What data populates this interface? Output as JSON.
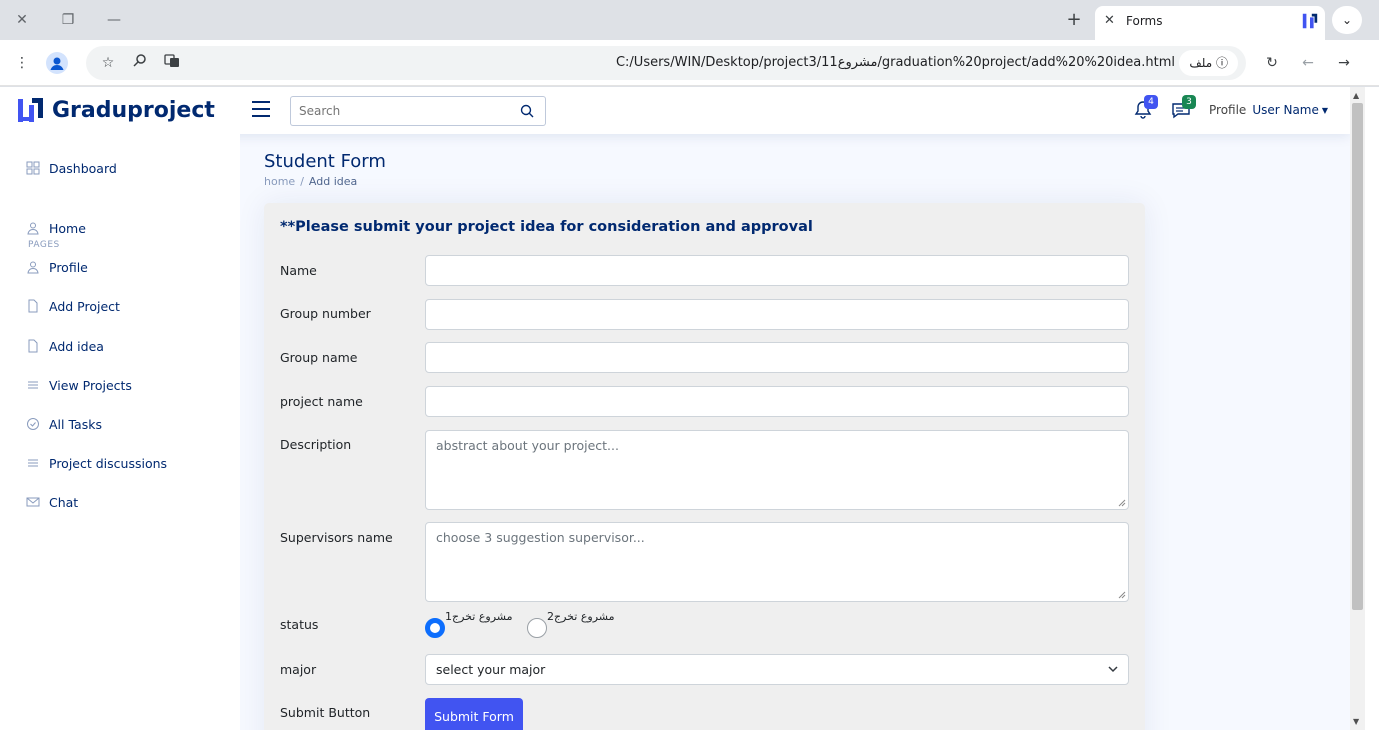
{
  "browser": {
    "tab_title": "Forms",
    "url": "C:/Users/WIN/Desktop/project3/11مشروع/graduation%20project/add%20%20idea.html",
    "file_chip": "ملف"
  },
  "header": {
    "brand": "Graduproject",
    "search_placeholder": "Search",
    "notifications_count": "4",
    "messages_count": "3",
    "profile_img_alt": "Profile",
    "user_name": "User Name"
  },
  "sidebar": {
    "section_heading": "PAGES",
    "items": [
      {
        "label": "Dashboard"
      },
      {
        "label": "Home"
      },
      {
        "label": "Profile"
      },
      {
        "label": "Add Project"
      },
      {
        "label": "Add idea"
      },
      {
        "label": "View Projects"
      },
      {
        "label": "All Tasks"
      },
      {
        "label": "Project discussions"
      },
      {
        "label": "Chat"
      }
    ]
  },
  "main": {
    "title": "Student Form",
    "breadcrumb": [
      "home",
      "Add idea"
    ],
    "card_title": "**Please submit your project idea for consideration and approval",
    "fields": {
      "name_label": "Name",
      "group_number_label": "Group number",
      "group_name_label": "Group name",
      "project_name_label": "project name",
      "description_label": "Description",
      "description_placeholder": "abstract about your project...",
      "supervisors_label": "Supervisors name",
      "supervisors_placeholder": "choose 3 suggestion supervisor...",
      "status_label": "status",
      "status_option_1": "مشروع تخرج1",
      "status_option_2": "مشروع تخرج2",
      "major_label": "major",
      "major_selected": "select your major",
      "submit_label": "Submit Button",
      "submit_button": "Submit Form"
    }
  },
  "colors": {
    "primary": "#4154f1",
    "brand_navy": "#012970",
    "radio_checked": "#0d6efd",
    "badge_notifications": "#4154f1",
    "badge_messages": "#198754"
  }
}
